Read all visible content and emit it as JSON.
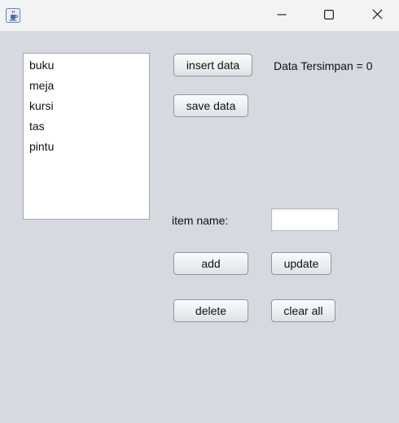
{
  "window": {
    "icons": {
      "app": "java-app-icon",
      "minimize": "minimize-icon",
      "maximize": "maximize-icon",
      "close": "close-icon"
    }
  },
  "list": {
    "items": [
      "buku",
      "meja",
      "kursi",
      "tas",
      "pintu"
    ]
  },
  "buttons": {
    "insert_data": "insert data",
    "save_data": "save data",
    "add": "add",
    "update": "update",
    "delete": "delete",
    "clear_all": "clear all"
  },
  "status": {
    "text": "Data Tersimpan = 0"
  },
  "form": {
    "item_name_label": "item name:",
    "item_name_value": ""
  },
  "colors": {
    "background": "#d6d9e0",
    "titlebar": "#f3f3f3",
    "button_border": "#8f959d"
  }
}
